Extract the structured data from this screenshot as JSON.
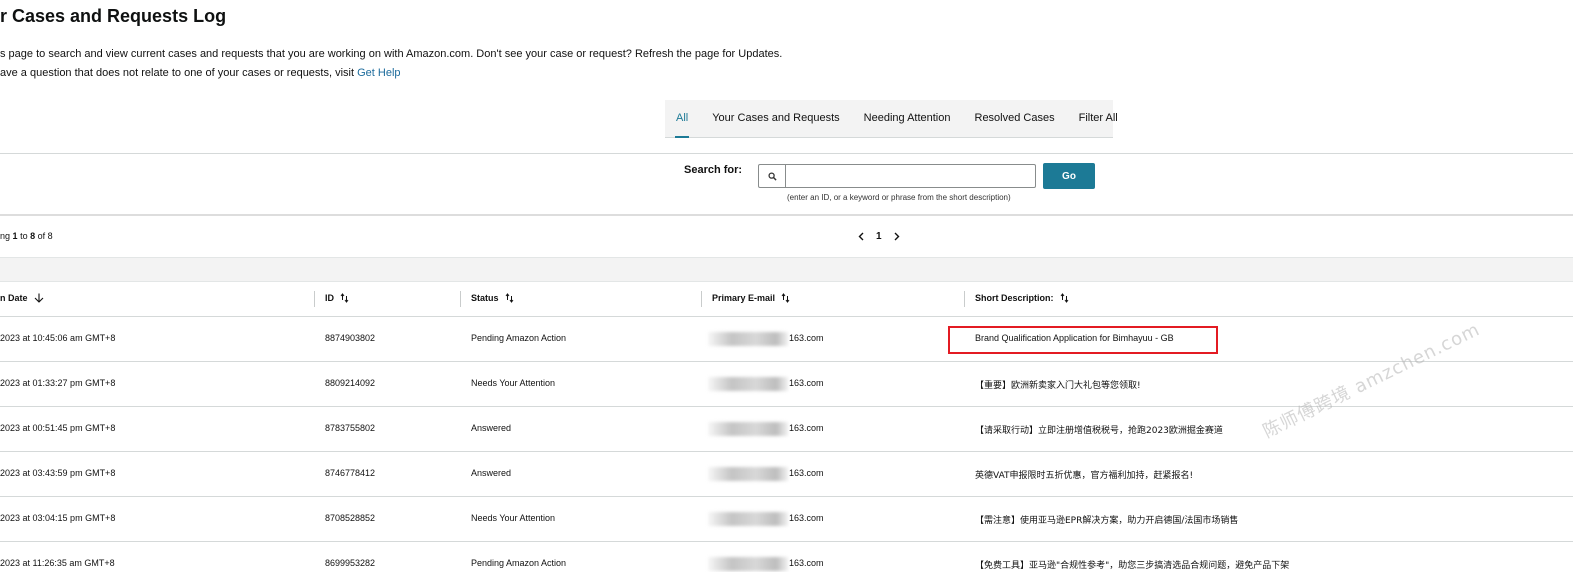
{
  "page": {
    "title": "r Cases and Requests Log",
    "intro_line1": "s page to search and view current cases and requests that you are working on with Amazon.com. Don't see your case or request? Refresh the page for Updates.",
    "intro_line2_prefix": "ave a question that does not relate to one of your cases or requests, visit ",
    "get_help_link": "Get Help"
  },
  "tabs": [
    {
      "label": "All",
      "active": true
    },
    {
      "label": "Your Cases and Requests",
      "active": false
    },
    {
      "label": "Needing Attention",
      "active": false
    },
    {
      "label": "Resolved Cases",
      "active": false
    },
    {
      "label": "Filter All",
      "active": false
    }
  ],
  "search": {
    "label": "Search for:",
    "value": "",
    "placeholder": "",
    "button": "Go",
    "hint": "(enter an ID, or a keyword or phrase from the short description)",
    "icon": "search-icon"
  },
  "pagination": {
    "prefix": "ng",
    "from": "1",
    "to_word": "to",
    "to": "8",
    "of_word": "of",
    "total": "8",
    "current_page": "1"
  },
  "table": {
    "columns": [
      "n Date",
      "ID",
      "Status",
      "Primary E-mail",
      "Short Description:"
    ],
    "rows": [
      {
        "date": "2023 at 10:45:06 am GMT+8",
        "id": "8874903802",
        "status": "Pending Amazon Action",
        "email": "163.com",
        "description": "Brand Qualification Application for Bimhayuu - GB"
      },
      {
        "date": "2023 at 01:33:27 pm GMT+8",
        "id": "8809214092",
        "status": "Needs Your Attention",
        "email": "163.com",
        "description": "【重要】欧洲新卖家入门大礼包等您领取!"
      },
      {
        "date": "2023 at 00:51:45 pm GMT+8",
        "id": "8783755802",
        "status": "Answered",
        "email": "163.com",
        "description": "【请采取行动】立即注册增值税税号，抢跑2023欧洲掘金赛道"
      },
      {
        "date": "2023 at 03:43:59 pm GMT+8",
        "id": "8746778412",
        "status": "Answered",
        "email": "163.com",
        "description": "英德VAT申报限时五折优惠，官方福利加持，赶紧报名!"
      },
      {
        "date": "2023 at 03:04:15 pm GMT+8",
        "id": "8708528852",
        "status": "Needs Your Attention",
        "email": "163.com",
        "description": "【需注意】使用亚马逊EPR解决方案，助力开启德国/法国市场销售"
      },
      {
        "date": "2023 at 11:26:35 am GMT+8",
        "id": "8699953282",
        "status": "Pending Amazon Action",
        "email": "163.com",
        "description": "【免费工具】亚马逊\"合规性参考\"，助您三步搞清选品合规问题，避免产品下架"
      }
    ]
  },
  "watermark": "陈师傅跨境 amzchen.com",
  "colors": {
    "accent": "#1c7a96",
    "highlight": "#e31b23",
    "link": "#1c6b9c"
  }
}
